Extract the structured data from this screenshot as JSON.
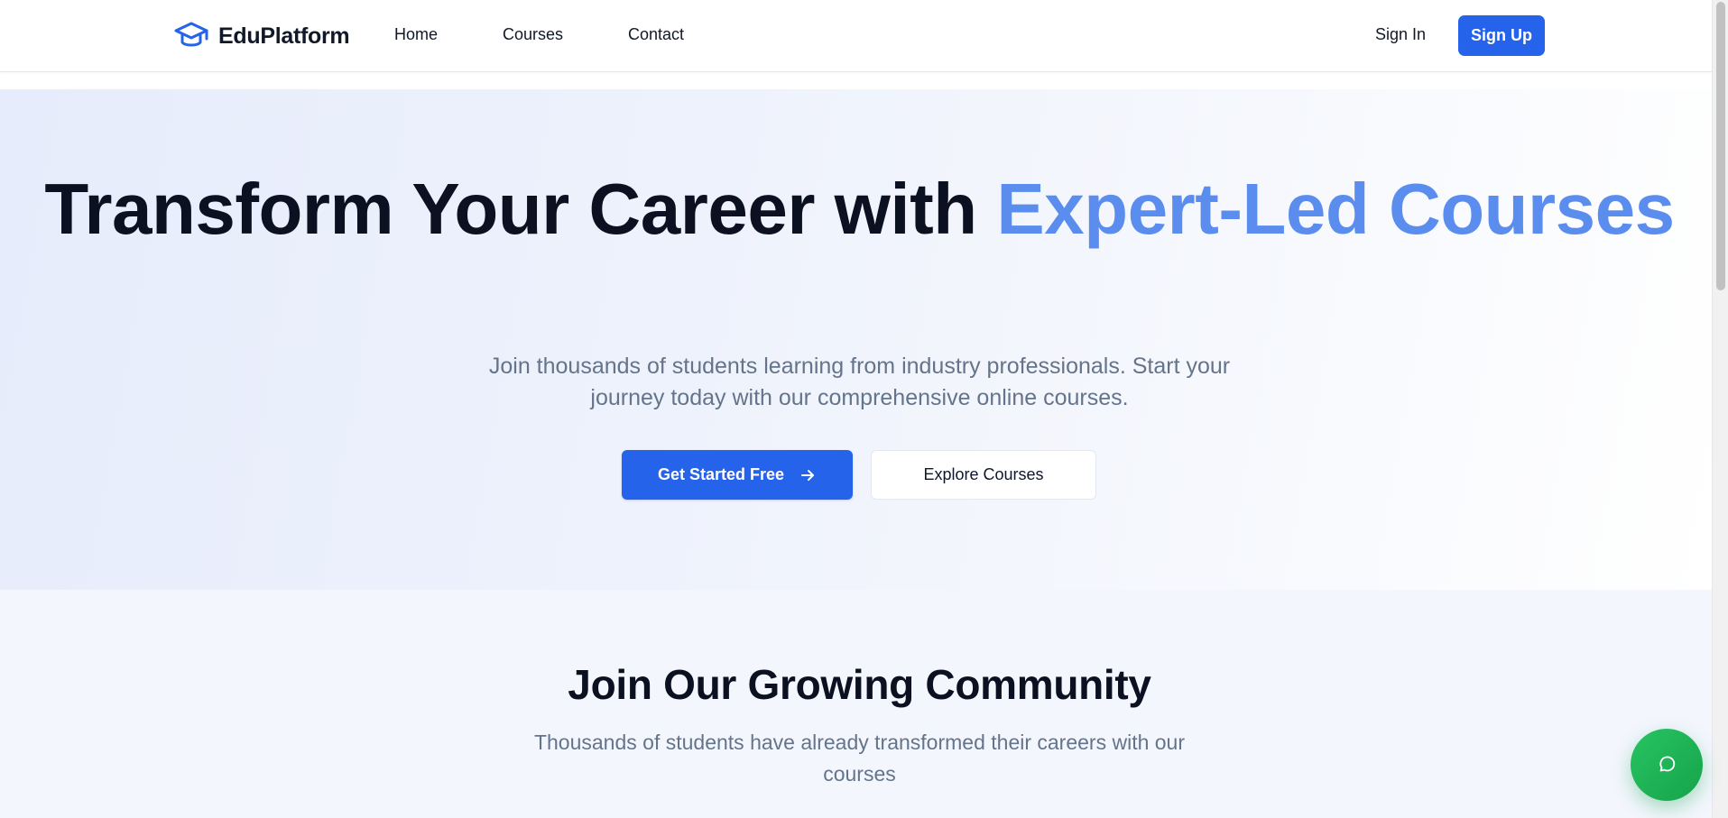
{
  "header": {
    "brand": "EduPlatform",
    "nav": {
      "home": "Home",
      "courses": "Courses",
      "contact": "Contact"
    },
    "sign_in": "Sign In",
    "sign_up": "Sign Up"
  },
  "hero": {
    "title_main": "Transform Your Career with ",
    "title_accent": "Expert-Led Courses",
    "subtitle": "Join thousands of students learning from industry professionals. Start your journey today with our comprehensive online courses.",
    "primary_button": "Get Started Free",
    "secondary_button": "Explore Courses"
  },
  "community": {
    "title": "Join Our Growing Community",
    "subtitle": "Thousands of students have already transformed their careers with our courses"
  },
  "icons": {
    "logo": "graduation-cap-icon",
    "primary_button": "arrow-right-icon",
    "chat": "message-circle-icon"
  },
  "colors": {
    "primary": "#2563eb",
    "accent_text": "#5b8def",
    "chat_button": "#16a34a",
    "muted_text": "#64748b"
  }
}
